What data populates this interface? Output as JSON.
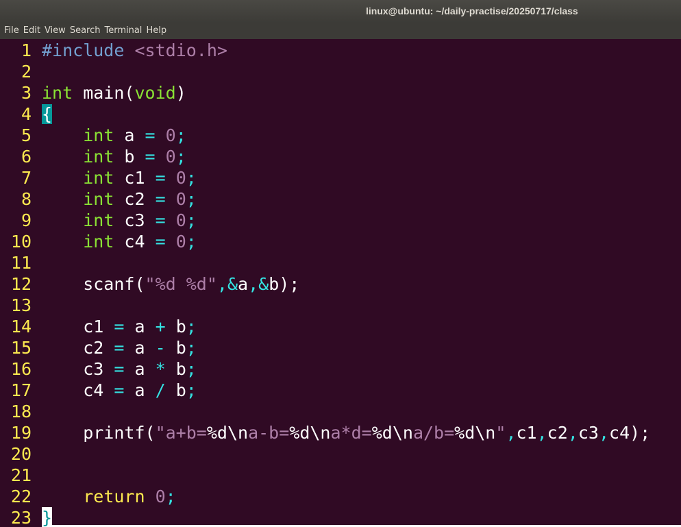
{
  "window": {
    "title": "linux@ubuntu: ~/daily-practise/20250717/class"
  },
  "menubar": {
    "items": [
      "File",
      "Edit",
      "View",
      "Search",
      "Terminal",
      "Help"
    ]
  },
  "editor": {
    "lines": [
      {
        "n": "1",
        "tokens": [
          {
            "t": "#include",
            "c": "preproc"
          },
          {
            "t": " "
          },
          {
            "t": "<stdio.h>",
            "c": "include"
          }
        ]
      },
      {
        "n": "2",
        "tokens": []
      },
      {
        "n": "3",
        "tokens": [
          {
            "t": "int",
            "c": "type"
          },
          {
            "t": " main("
          },
          {
            "t": "void",
            "c": "type"
          },
          {
            "t": ")"
          }
        ]
      },
      {
        "n": "4",
        "tokens": [
          {
            "t": "{",
            "c": "brace-match"
          }
        ]
      },
      {
        "n": "5",
        "tokens": [
          {
            "t": "    "
          },
          {
            "t": "int",
            "c": "type"
          },
          {
            "t": " a "
          },
          {
            "t": "=",
            "c": "op"
          },
          {
            "t": " "
          },
          {
            "t": "0",
            "c": "num"
          },
          {
            "t": ";",
            "c": "op"
          }
        ]
      },
      {
        "n": "6",
        "tokens": [
          {
            "t": "    "
          },
          {
            "t": "int",
            "c": "type"
          },
          {
            "t": " b "
          },
          {
            "t": "=",
            "c": "op"
          },
          {
            "t": " "
          },
          {
            "t": "0",
            "c": "num"
          },
          {
            "t": ";",
            "c": "op"
          }
        ]
      },
      {
        "n": "7",
        "tokens": [
          {
            "t": "    "
          },
          {
            "t": "int",
            "c": "type"
          },
          {
            "t": " c1 "
          },
          {
            "t": "=",
            "c": "op"
          },
          {
            "t": " "
          },
          {
            "t": "0",
            "c": "num"
          },
          {
            "t": ";",
            "c": "op"
          }
        ]
      },
      {
        "n": "8",
        "tokens": [
          {
            "t": "    "
          },
          {
            "t": "int",
            "c": "type"
          },
          {
            "t": " c2 "
          },
          {
            "t": "=",
            "c": "op"
          },
          {
            "t": " "
          },
          {
            "t": "0",
            "c": "num"
          },
          {
            "t": ";",
            "c": "op"
          }
        ]
      },
      {
        "n": "9",
        "tokens": [
          {
            "t": "    "
          },
          {
            "t": "int",
            "c": "type"
          },
          {
            "t": " c3 "
          },
          {
            "t": "=",
            "c": "op"
          },
          {
            "t": " "
          },
          {
            "t": "0",
            "c": "num"
          },
          {
            "t": ";",
            "c": "op"
          }
        ]
      },
      {
        "n": "10",
        "tokens": [
          {
            "t": "    "
          },
          {
            "t": "int",
            "c": "type"
          },
          {
            "t": " c4 "
          },
          {
            "t": "=",
            "c": "op"
          },
          {
            "t": " "
          },
          {
            "t": "0",
            "c": "num"
          },
          {
            "t": ";",
            "c": "op"
          }
        ]
      },
      {
        "n": "11",
        "tokens": []
      },
      {
        "n": "12",
        "tokens": [
          {
            "t": "    scanf("
          },
          {
            "t": "\"",
            "c": "str"
          },
          {
            "t": "%d %d",
            "c": "str"
          },
          {
            "t": "\"",
            "c": "str"
          },
          {
            "t": ",&",
            "c": "op"
          },
          {
            "t": "a"
          },
          {
            "t": ",&",
            "c": "op"
          },
          {
            "t": "b);"
          }
        ]
      },
      {
        "n": "13",
        "tokens": []
      },
      {
        "n": "14",
        "tokens": [
          {
            "t": "    c1 "
          },
          {
            "t": "=",
            "c": "op"
          },
          {
            "t": " a "
          },
          {
            "t": "+",
            "c": "op"
          },
          {
            "t": " b"
          },
          {
            "t": ";",
            "c": "op"
          }
        ]
      },
      {
        "n": "15",
        "tokens": [
          {
            "t": "    c2 "
          },
          {
            "t": "=",
            "c": "op"
          },
          {
            "t": " a "
          },
          {
            "t": "-",
            "c": "op"
          },
          {
            "t": " b"
          },
          {
            "t": ";",
            "c": "op"
          }
        ]
      },
      {
        "n": "16",
        "tokens": [
          {
            "t": "    c3 "
          },
          {
            "t": "=",
            "c": "op"
          },
          {
            "t": " a "
          },
          {
            "t": "*",
            "c": "op"
          },
          {
            "t": " b"
          },
          {
            "t": ";",
            "c": "op"
          }
        ]
      },
      {
        "n": "17",
        "tokens": [
          {
            "t": "    c4 "
          },
          {
            "t": "=",
            "c": "op"
          },
          {
            "t": " a "
          },
          {
            "t": "/",
            "c": "op"
          },
          {
            "t": " b"
          },
          {
            "t": ";",
            "c": "op"
          }
        ]
      },
      {
        "n": "18",
        "tokens": []
      },
      {
        "n": "19",
        "tokens": [
          {
            "t": "    printf("
          },
          {
            "t": "\"a+b=",
            "c": "str"
          },
          {
            "t": "%d\\n",
            "c": "esc"
          },
          {
            "t": "a-b=",
            "c": "str"
          },
          {
            "t": "%d\\n",
            "c": "esc"
          },
          {
            "t": "a*d=",
            "c": "str"
          },
          {
            "t": "%d\\n",
            "c": "esc"
          },
          {
            "t": "a/b=",
            "c": "str"
          },
          {
            "t": "%d\\n",
            "c": "esc"
          },
          {
            "t": "\"",
            "c": "str"
          },
          {
            "t": ",",
            "c": "op"
          },
          {
            "t": "c1"
          },
          {
            "t": ",",
            "c": "op"
          },
          {
            "t": "c2"
          },
          {
            "t": ",",
            "c": "op"
          },
          {
            "t": "c3"
          },
          {
            "t": ",",
            "c": "op"
          },
          {
            "t": "c4);"
          }
        ]
      },
      {
        "n": "20",
        "tokens": []
      },
      {
        "n": "21",
        "tokens": []
      },
      {
        "n": "22",
        "tokens": [
          {
            "t": "    "
          },
          {
            "t": "return",
            "c": "kw"
          },
          {
            "t": " "
          },
          {
            "t": "0",
            "c": "num"
          },
          {
            "t": ";",
            "c": "op"
          }
        ]
      },
      {
        "n": "23",
        "tokens": [
          {
            "t": "}",
            "c": "brace-cursor"
          }
        ]
      }
    ]
  }
}
